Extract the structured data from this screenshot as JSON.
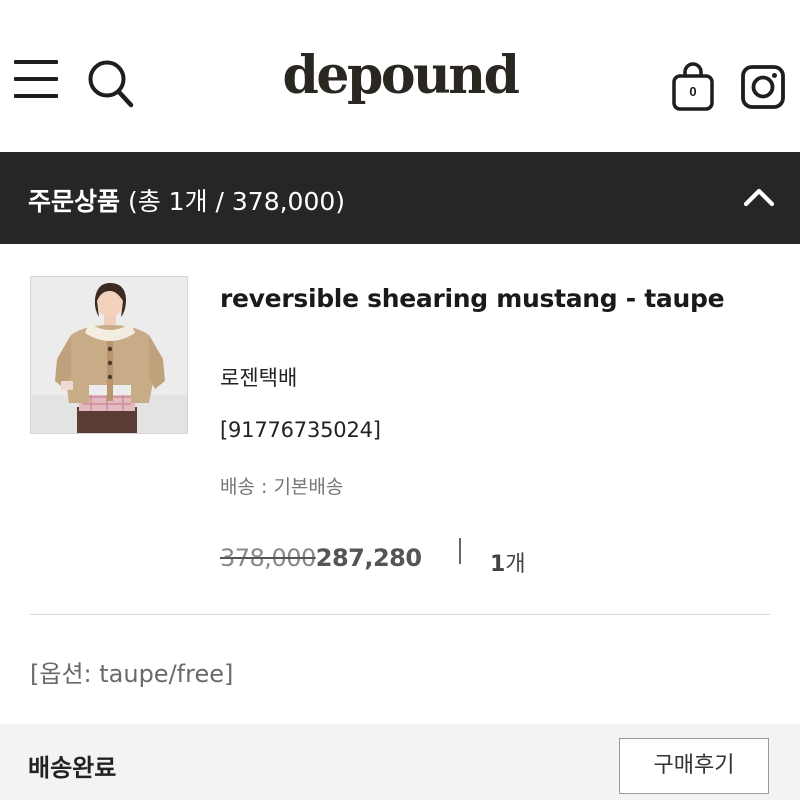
{
  "header": {
    "logo_text": "depound",
    "cart_count": "0"
  },
  "order_summary": {
    "title": "주문상품",
    "summary": "(총 1개 / 378,000)"
  },
  "product": {
    "name": "reversible shearing mustang - taupe",
    "carrier": "로젠택배",
    "tracking_number": "[91776735024]",
    "shipping_method": "배송 : 기본배송",
    "original_price": "378,000",
    "sale_price": "287,280",
    "quantity": "1",
    "quantity_unit": "개",
    "option": "[옵션: taupe/free]"
  },
  "order_status": {
    "status": "배송완료",
    "review_button": "구매후기"
  },
  "colors": {
    "header_bar": "#262626",
    "footer_bar": "#f3f3f3",
    "jacket": "#c8ac88"
  }
}
